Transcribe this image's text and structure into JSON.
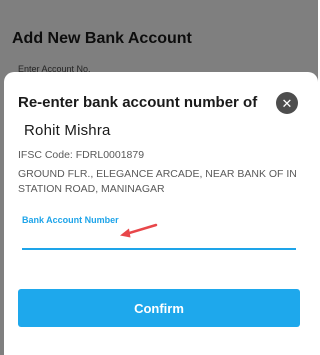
{
  "background_page": {
    "title": "Add New Bank Account",
    "field_label": "Enter Account No."
  },
  "modal": {
    "title": "Re-enter bank account number of",
    "close_icon": "close-icon",
    "account_holder": "Rohit Mishra",
    "ifsc": "IFSC Code: FDRL0001879",
    "branch_address": "GROUND FLR., ELEGANCE ARCADE, NEAR BANK OF IN STATION ROAD, MANINAGAR",
    "field": {
      "label": "Bank Account Number",
      "value": "",
      "placeholder": ""
    },
    "confirm_label": "Confirm"
  },
  "colors": {
    "accent": "#1ea8ec",
    "close_button": "#4d4d4d",
    "annotation_arrow": "#e8474a"
  }
}
